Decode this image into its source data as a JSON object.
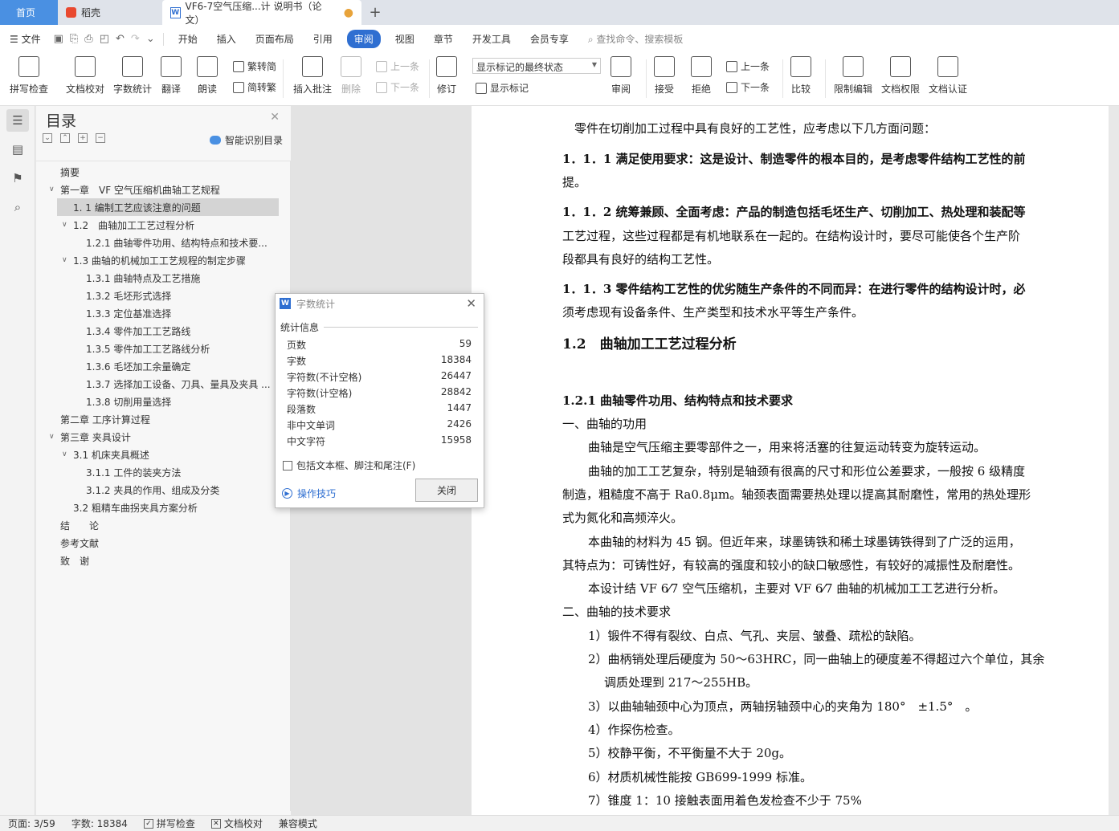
{
  "tabs": {
    "home": "首页",
    "daoke": "稻壳",
    "doc": "VF6-7空气压缩...计 说明书（论文）",
    "doc_modified": "●",
    "add": "+"
  },
  "menubar": {
    "file": "文件",
    "items": [
      "开始",
      "插入",
      "页面布局",
      "引用",
      "审阅",
      "视图",
      "章节",
      "开发工具",
      "会员专享"
    ],
    "active": "审阅",
    "search": "查找命令、搜索模板"
  },
  "ribbon": {
    "spell_check": "拼写检查",
    "doc_proof": "文档校对",
    "word_count": "字数统计",
    "translate": "翻译",
    "read_aloud": "朗读",
    "trad_conv": "繁转简",
    "simp_conv": "简转繁",
    "insert_comment": "插入批注",
    "delete": "删除",
    "prev": "上一条",
    "next": "下一条",
    "track": "修订",
    "markup_select": "显示标记的最终状态",
    "show_markup": "显示标记",
    "review": "审阅",
    "accept": "接受",
    "reject": "拒绝",
    "prev2": "上一条",
    "next2": "下一条",
    "compare": "比较",
    "restrict_edit": "限制编辑",
    "doc_perm": "文档权限",
    "doc_cert": "文档认证"
  },
  "toc": {
    "title": "目录",
    "smart": "智能识别目录",
    "items": [
      {
        "label": "摘要",
        "indent": 0,
        "arrow": ""
      },
      {
        "label": "第一章　VF 空气压缩机曲轴工艺规程",
        "indent": 0,
        "arrow": "v"
      },
      {
        "label": "1. 1  编制工艺应该注意的问题",
        "indent": 2,
        "arrow": "",
        "selected": true
      },
      {
        "label": "1.2　曲轴加工工艺过程分析",
        "indent": 1,
        "arrow": "v"
      },
      {
        "label": "1.2.1  曲轴零件功用、结构特点和技术要...",
        "indent": 3,
        "arrow": ""
      },
      {
        "label": "1.3  曲轴的机械加工工艺规程的制定步骤",
        "indent": 1,
        "arrow": "v"
      },
      {
        "label": "1.3.1 曲轴特点及工艺措施",
        "indent": 3,
        "arrow": ""
      },
      {
        "label": "1.3.2  毛坯形式选择",
        "indent": 3,
        "arrow": ""
      },
      {
        "label": "1.3.3  定位基准选择",
        "indent": 3,
        "arrow": ""
      },
      {
        "label": "1.3.4  零件加工工艺路线",
        "indent": 3,
        "arrow": ""
      },
      {
        "label": "1.3.5  零件加工工艺路线分析",
        "indent": 3,
        "arrow": ""
      },
      {
        "label": "1.3.6  毛坯加工余量确定",
        "indent": 3,
        "arrow": ""
      },
      {
        "label": "1.3.7  选择加工设备、刀具、量具及夹具 ...",
        "indent": 3,
        "arrow": ""
      },
      {
        "label": "1.3.8  切削用量选择",
        "indent": 3,
        "arrow": ""
      },
      {
        "label": "第二章  工序计算过程",
        "indent": 0,
        "arrow": ""
      },
      {
        "label": "第三章  夹具设计",
        "indent": 0,
        "arrow": "v"
      },
      {
        "label": "3.1  机床夹具概述",
        "indent": 1,
        "arrow": "v"
      },
      {
        "label": "3.1.1  工件的装夹方法",
        "indent": 3,
        "arrow": ""
      },
      {
        "label": "3.1.2  夹具的作用、组成及分类",
        "indent": 3,
        "arrow": ""
      },
      {
        "label": "3.2  粗精车曲拐夹具方案分析",
        "indent": 2,
        "arrow": ""
      },
      {
        "label": "结　　论",
        "indent": 0,
        "arrow": ""
      },
      {
        "label": "参考文献",
        "indent": 0,
        "arrow": ""
      },
      {
        "label": "致　谢",
        "indent": 0,
        "arrow": ""
      }
    ]
  },
  "dialog": {
    "title": "字数统计",
    "section": "统计信息",
    "stats": [
      {
        "label": "页数",
        "value": "59"
      },
      {
        "label": "字数",
        "value": "18384"
      },
      {
        "label": "字符数(不计空格)",
        "value": "26447"
      },
      {
        "label": "字符数(计空格)",
        "value": "28842"
      },
      {
        "label": "段落数",
        "value": "1447"
      },
      {
        "label": "非中文单词",
        "value": "2426"
      },
      {
        "label": "中文字符",
        "value": "15958"
      }
    ],
    "include_label": "包括文本框、脚注和尾注(F)",
    "include_checked": false,
    "tips": "操作技巧",
    "close": "关闭"
  },
  "document": {
    "lines": [
      {
        "text": "零件在切削加工过程中具有良好的工艺性，应考虑以下几方面问题：",
        "style": "",
        "indent": 1
      },
      {
        "text": "1．1．1 满足使用要求：这是设计、制造零件的根本目的，是考虑零件结构工艺性的前",
        "style": "b",
        "indent": 0
      },
      {
        "text": "提。",
        "style": "",
        "indent": 0
      },
      {
        "text": "1．1．2 统筹兼顾、全面考虑：产品的制造包括毛坯生产、切削加工、热处理和装配等",
        "style": "b",
        "indent": 0
      },
      {
        "text": "工艺过程，这些过程都是有机地联系在一起的。在结构设计时，要尽可能使各个生产阶",
        "style": "",
        "indent": 0
      },
      {
        "text": "段都具有良好的结构工艺性。",
        "style": "",
        "indent": 0
      },
      {
        "text": "1．1．3 零件结构工艺性的优劣随生产条件的不同而异：在进行零件的结构设计时，必",
        "style": "b",
        "indent": 0
      },
      {
        "text": "须考虑现有设备条件、生产类型和技术水平等生产条件。",
        "style": "",
        "indent": 0
      },
      {
        "text": "1.2　曲轴加工工艺过程分析",
        "style": "h2",
        "indent": 0
      },
      {
        "text": "1.2.1 曲轴零件功用、结构特点和技术要求",
        "style": "h",
        "indent": 0
      },
      {
        "text": "一、曲轴的功用",
        "style": "",
        "indent": 0
      },
      {
        "text": "曲轴是空气压缩主要零部件之一，用来将活塞的往复运动转变为旋转运动。",
        "style": "",
        "indent": 2
      },
      {
        "text": "曲轴的加工工艺复杂，特别是轴颈有很高的尺寸和形位公差要求，一般按 6 级精度",
        "style": "",
        "indent": 2
      },
      {
        "text": "制造，粗糙度不高于 Ra0.8μm。轴颈表面需要热处理以提高其耐磨性，常用的热处理形",
        "style": "",
        "indent": 0
      },
      {
        "text": "式为氮化和高频淬火。",
        "style": "",
        "indent": 0
      },
      {
        "text": "本曲轴的材料为 45 钢。但近年来，球墨铸铁和稀土球墨铸铁得到了广泛的运用，",
        "style": "",
        "indent": 2
      },
      {
        "text": "其特点为：可铸性好，有较高的强度和较小的缺口敏感性，有较好的减振性及耐磨性。",
        "style": "",
        "indent": 0
      },
      {
        "text": "本设计结 VF 6⁄7 空气压缩机，主要对 VF 6⁄7 曲轴的机械加工工艺进行分析。",
        "style": "",
        "indent": 2
      },
      {
        "text": "二、曲轴的技术要求",
        "style": "",
        "indent": 0
      },
      {
        "text": "1）锻件不得有裂纹、白点、气孔、夹层、皱叠、疏松的缺陷。",
        "style": "",
        "indent": 2
      },
      {
        "text": "2）曲柄销处理后硬度为 50～63HRC，同一曲轴上的硬度差不得超过六个单位，其余",
        "style": "",
        "indent": 2
      },
      {
        "text": "调质处理到 217～255HB。",
        "style": "",
        "indent": 3
      },
      {
        "text": "3）以曲轴轴颈中心为顶点，两轴拐轴颈中心的夹角为 180°　±1.5°　。",
        "style": "",
        "indent": 2
      },
      {
        "text": "4）作探伤检查。",
        "style": "",
        "indent": 2
      },
      {
        "text": "5）校静平衡，不平衡量不大于 20g。",
        "style": "",
        "indent": 2
      },
      {
        "text": "6）材质机械性能按 GB699-1999 标准。",
        "style": "",
        "indent": 2
      },
      {
        "text": "7）锥度 1：10 接触表面用着色发检查不少于 75%",
        "style": "",
        "indent": 2
      }
    ]
  },
  "status": {
    "page": "页面: 3/59",
    "words": "字数: 18384",
    "spell": "拼写检查",
    "proof": "文档校对",
    "compat": "兼容模式"
  }
}
